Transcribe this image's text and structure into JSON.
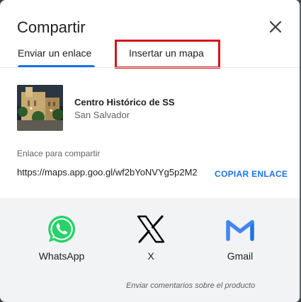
{
  "dialog": {
    "title": "Compartir"
  },
  "tabs": [
    {
      "label": "Enviar un enlace"
    },
    {
      "label": "Insertar un mapa"
    }
  ],
  "place": {
    "name": "Centro Histórico de SS",
    "address": "San Salvador"
  },
  "share_link": {
    "label": "Enlace para compartir",
    "url": "https://maps.app.goo.gl/wf2bYoNVYg5p2M2",
    "copy_label": "COPIAR ENLACE"
  },
  "apps": [
    {
      "label": "WhatsApp",
      "icon": "whatsapp-icon"
    },
    {
      "label": "X",
      "icon": "x-icon"
    },
    {
      "label": "Gmail",
      "icon": "gmail-icon"
    }
  ],
  "footer": {
    "feedback": "Enviar comentarios sobre el producto"
  },
  "colors": {
    "accent": "#1a73e8",
    "highlight": "#d3161c",
    "whatsapp": "#25d366"
  }
}
